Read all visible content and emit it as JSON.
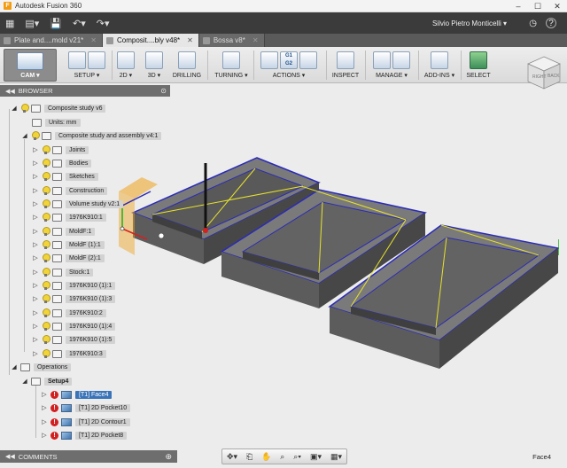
{
  "window": {
    "title": "Autodesk Fusion 360",
    "app_icon": "F"
  },
  "quick_access": {
    "user_name": "Silvio Pietro Monticelli ▾"
  },
  "tabs": [
    {
      "label": "Plate and....mold v21*",
      "active": false
    },
    {
      "label": "Composit....bly v48*",
      "active": true
    },
    {
      "label": "Bossa v8*",
      "active": false
    }
  ],
  "ribbon": {
    "cam_label": "CAM ▾",
    "groups": [
      {
        "label": "SETUP ▾"
      },
      {
        "label": "2D ▾"
      },
      {
        "label": "3D ▾"
      },
      {
        "label": "DRILLING"
      },
      {
        "label": "TURNING ▾"
      },
      {
        "label": "ACTIONS ▾"
      },
      {
        "label": "INSPECT"
      },
      {
        "label": "MANAGE ▾"
      },
      {
        "label": "ADD-INS ▾"
      },
      {
        "label": "SELECT"
      }
    ],
    "actions_g1": "G1",
    "actions_g2": "G2"
  },
  "viewcube": {
    "right": "RIGHT",
    "back": "BACK"
  },
  "browser": {
    "title": "BROWSER",
    "items": [
      {
        "label": "Composite study v6"
      },
      {
        "label": "Units: mm"
      },
      {
        "label": "Composite study and assembly v4:1"
      },
      {
        "label": "Joints"
      },
      {
        "label": "Bodies"
      },
      {
        "label": "Sketches"
      },
      {
        "label": "Construction"
      },
      {
        "label": "Volume study v2:1"
      },
      {
        "label": "1976K910:1"
      },
      {
        "label": "MoldF:1"
      },
      {
        "label": "MoldF (1):1"
      },
      {
        "label": "MoldF (2):1"
      },
      {
        "label": "Stock:1"
      },
      {
        "label": "1976K910 (1):1"
      },
      {
        "label": "1976K910 (1):3"
      },
      {
        "label": "1976K910:2"
      },
      {
        "label": "1976K910 (1):4"
      },
      {
        "label": "1976K910 (1):5"
      },
      {
        "label": "1976K910:3"
      },
      {
        "label": "Operations"
      },
      {
        "label": "Setup4"
      },
      {
        "label": "[T1] Face4"
      },
      {
        "label": "[T1] 2D Pocket10"
      },
      {
        "label": "[T1] 2D Contour1"
      },
      {
        "label": "[T1] 2D Pocket8"
      }
    ]
  },
  "comments": {
    "title": "COMMENTS"
  },
  "status": {
    "selection": "Face4"
  }
}
